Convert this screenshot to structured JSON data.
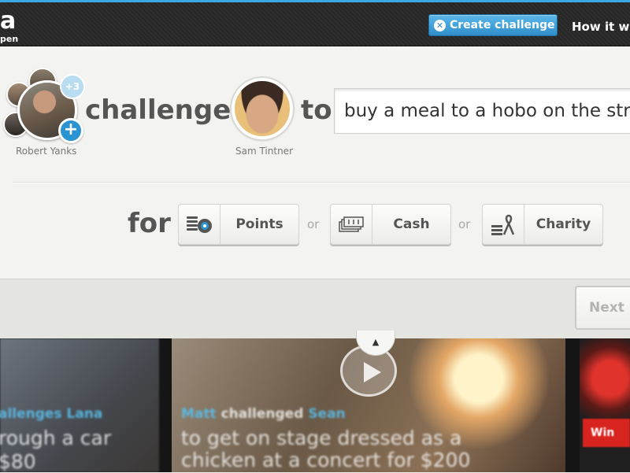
{
  "topbar": {
    "logo_big": "a",
    "logo_small": "pen",
    "create_label": "Create challenge",
    "how_it_label": "How it wo"
  },
  "challenger": {
    "name": "Robert Yanks",
    "extra_count": "+3",
    "add_label": "+"
  },
  "sentence": {
    "challenges_word": "challenges",
    "to_word": "to",
    "for_word": "for",
    "or_word": "or"
  },
  "challenged": {
    "name": "Sam Tintner"
  },
  "task_input": {
    "value": "buy a meal to a hobo on the stree"
  },
  "rewards": [
    {
      "label": "Points",
      "icon": "coins-icon"
    },
    {
      "label": "Cash",
      "icon": "cash-icon"
    },
    {
      "label": "Charity",
      "icon": "charity-ribbon-icon"
    }
  ],
  "footer": {
    "next_label": "Next S",
    "collapse_glyph": "▲"
  },
  "feed": {
    "tile1": {
      "line1_blue": "allenges Lana",
      "line2": "rough a car",
      "line3": "$80"
    },
    "tile2": {
      "user1": "Matt",
      "verb": "challenged",
      "user2": "Sean",
      "line2": "to get on stage dressed as a",
      "line3": "chicken at a concert for $200"
    },
    "tile3": {
      "banner": "Win"
    }
  },
  "colors": {
    "accent": "#2a93d2",
    "topbar": "#2a2a2a",
    "win_red": "#d8241f"
  }
}
